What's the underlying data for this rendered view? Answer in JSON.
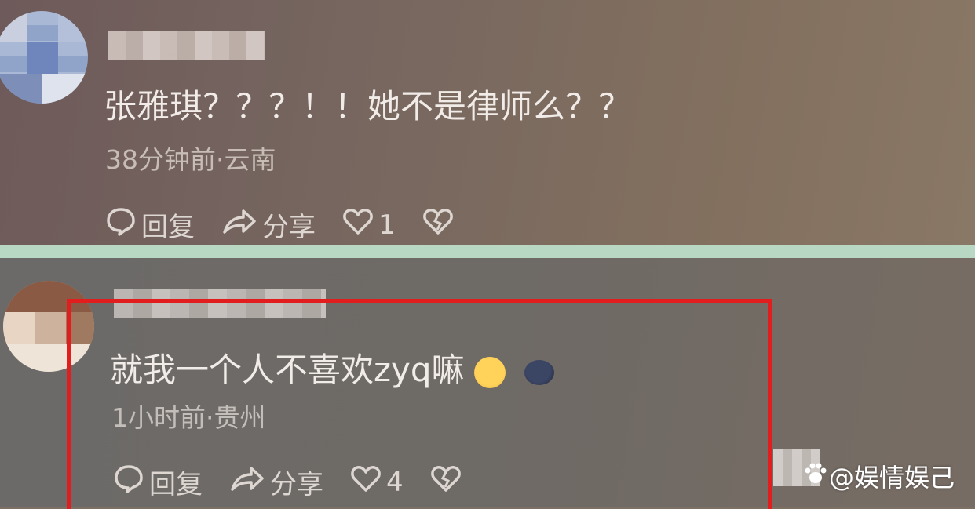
{
  "comments": [
    {
      "text": "张雅琪？？？！！她不是律师么？？",
      "meta": "38分钟前·云南",
      "reply_label": "回复",
      "share_label": "分享",
      "like_count": "1"
    },
    {
      "text": "就我一个人不喜欢zyq嘛",
      "meta": "1小时前·贵州",
      "reply_label": "回复",
      "share_label": "分享",
      "like_count": "4"
    }
  ],
  "watermark": {
    "text": "@娱情娱己"
  },
  "colors": {
    "highlight": "#e21d1d",
    "divider": "#b8d8c4"
  },
  "icons": [
    "comment-icon",
    "share-icon",
    "heart-icon",
    "broken-heart-icon",
    "paw-icon"
  ]
}
